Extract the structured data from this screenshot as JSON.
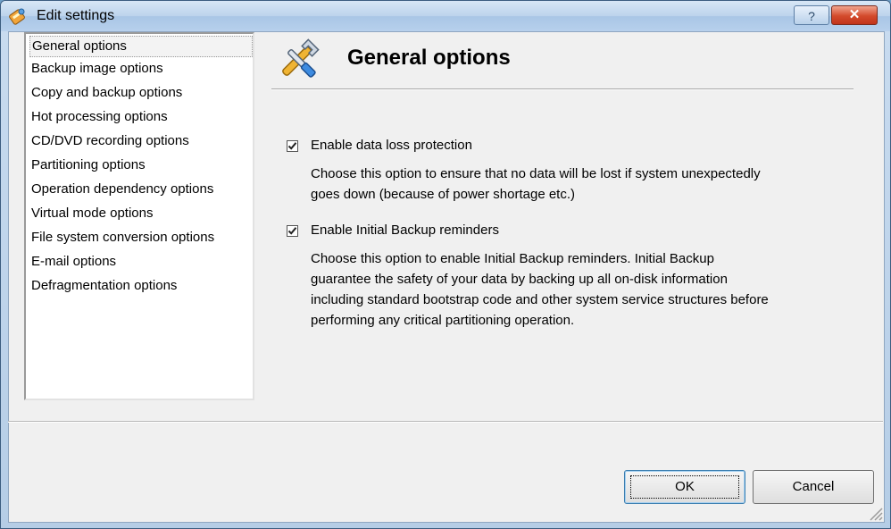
{
  "window": {
    "title": "Edit settings",
    "help_label": "?",
    "close_label": "✕"
  },
  "sidebar": {
    "items": [
      {
        "label": "General options",
        "selected": true
      },
      {
        "label": "Backup image options"
      },
      {
        "label": "Copy and backup options"
      },
      {
        "label": "Hot processing options"
      },
      {
        "label": "CD/DVD recording options"
      },
      {
        "label": "Partitioning options"
      },
      {
        "label": "Operation dependency options"
      },
      {
        "label": "Virtual mode options"
      },
      {
        "label": "File system conversion options"
      },
      {
        "label": "E-mail options"
      },
      {
        "label": "Defragmentation options"
      }
    ]
  },
  "panel": {
    "title": "General options",
    "icon": "tools-icon",
    "options": [
      {
        "label": "Enable data loss protection",
        "checked": true,
        "description": [
          "Choose this option to ensure that no data will be lost if system unexpectedly",
          "goes down (because of power shortage etc.)"
        ]
      },
      {
        "label": "Enable Initial Backup reminders",
        "checked": true,
        "description": [
          "Choose this option to enable Initial Backup reminders. Initial Backup",
          "guarantee the safety of your data by backing up all on-disk information",
          "including standard bootstrap code and other system service structures before",
          "performing any critical partitioning operation."
        ]
      }
    ]
  },
  "footer": {
    "ok_label": "OK",
    "cancel_label": "Cancel"
  },
  "colors": {
    "titlebar": "#bcd3ec",
    "close": "#c1331a",
    "client": "#f0f0f0"
  }
}
